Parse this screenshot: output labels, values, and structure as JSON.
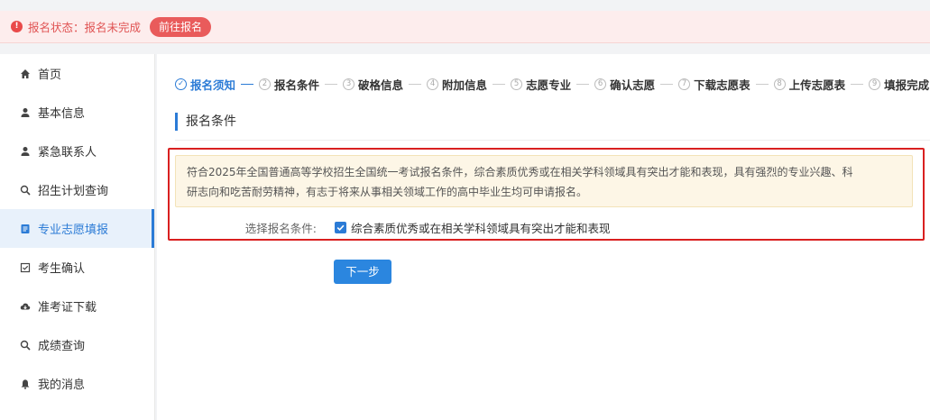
{
  "alert": {
    "icon_label": "!",
    "icon_color": "#e94a4a",
    "text": "报名状态：报名未完成",
    "button": "前往报名"
  },
  "sidebar": {
    "items": [
      {
        "label": "首页",
        "icon": "home-icon"
      },
      {
        "label": "基本信息",
        "icon": "user-icon"
      },
      {
        "label": "紧急联系人",
        "icon": "user-icon"
      },
      {
        "label": "招生计划查询",
        "icon": "search-icon"
      },
      {
        "label": "专业志愿填报",
        "icon": "document-icon",
        "active": true
      },
      {
        "label": "考生确认",
        "icon": "checkbox-icon"
      },
      {
        "label": "准考证下载",
        "icon": "cloud-download-icon"
      },
      {
        "label": "成绩查询",
        "icon": "search-icon"
      },
      {
        "label": "我的消息",
        "icon": "bell-icon"
      }
    ]
  },
  "steps": [
    {
      "num": "✓",
      "label": "报名须知",
      "done": true
    },
    {
      "num": "2",
      "label": "报名条件"
    },
    {
      "num": "3",
      "label": "破格信息"
    },
    {
      "num": "4",
      "label": "附加信息"
    },
    {
      "num": "5",
      "label": "志愿专业"
    },
    {
      "num": "6",
      "label": "确认志愿"
    },
    {
      "num": "7",
      "label": "下载志愿表"
    },
    {
      "num": "8",
      "label": "上传志愿表"
    },
    {
      "num": "9",
      "label": "填报完成"
    }
  ],
  "section_title": "报名条件",
  "notice": {
    "line1": "符合2025年全国普通高等学校招生全国统一考试报名条件，综合素质优秀或在相关学科领域具有突出才能和表现，具有强烈的专业兴趣、科",
    "line2": "研志向和吃苦耐劳精神，有志于将来从事相关领域工作的高中毕业生均可申请报名。"
  },
  "condition": {
    "label": "选择报名条件:",
    "option": "综合素质优秀或在相关学科领域具有突出才能和表现",
    "checked": true
  },
  "next_button": "下一步",
  "colors": {
    "accent": "#2b7bd6",
    "alert_text": "#e05353",
    "highlight_box": "#d92020"
  }
}
